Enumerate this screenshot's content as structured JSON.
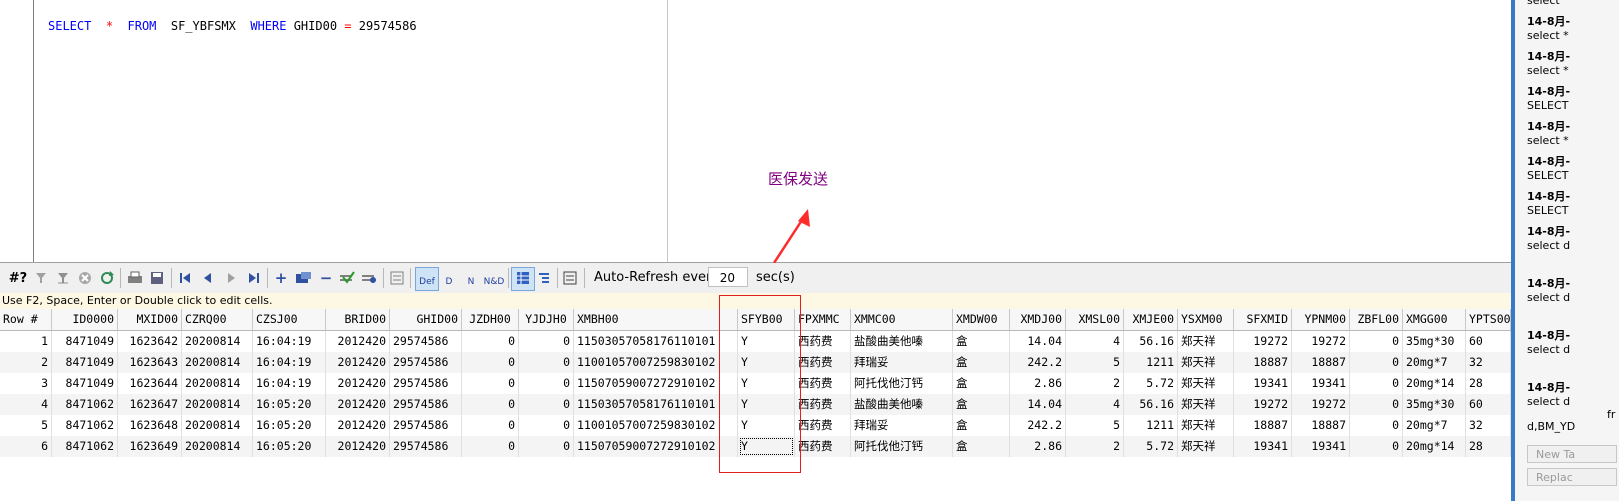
{
  "editor": {
    "sql_select": "SELECT",
    "sql_star": "*",
    "sql_from": "FROM",
    "sql_table": "SF_YBFSMX",
    "sql_where": "WHERE",
    "sql_col": "GHID00",
    "sql_eq": "=",
    "sql_val": "29574586"
  },
  "annotation": {
    "text": "医保发送",
    "color": "#ff2a2a"
  },
  "toolbar": {
    "first_label": "#?",
    "auto_refresh_label": "Auto-Refresh every",
    "refresh_seconds": "20",
    "seconds_unit": "sec(s)",
    "view_buttons": [
      "Def",
      "D",
      "N",
      "N&D"
    ]
  },
  "hint": "Use F2, Space, Enter or Double click to edit cells.",
  "grid": {
    "columns": [
      "Row #",
      "ID0000",
      "MXID00",
      "CZRQ00",
      "CZSJ00",
      "BRID00",
      "GHID00",
      "JZDH00",
      "YJDJH0",
      "XMBH00",
      "SFYB00",
      "FPXMMC",
      "XMMC00",
      "XMDW00",
      "XMDJ00",
      "XMSL00",
      "XMJE00",
      "YSXM00",
      "SFXMID",
      "YPNM00",
      "ZBFL00",
      "XMGG00",
      "YPTS00"
    ],
    "rows": [
      [
        "1",
        "8471049",
        "1623642",
        "20200814",
        "16:04:19",
        "2012420",
        "29574586",
        "0",
        "0",
        "11503057058176110101",
        "Y",
        "西药费",
        "盐酸曲美他嗪",
        "盒",
        "14.04",
        "4",
        "56.16",
        "郑天祥",
        "19272",
        "19272",
        "0",
        "35mg*30",
        "60"
      ],
      [
        "2",
        "8471049",
        "1623643",
        "20200814",
        "16:04:19",
        "2012420",
        "29574586",
        "0",
        "0",
        "11001057007259830102",
        "Y",
        "西药费",
        "拜瑞妥",
        "盒",
        "242.2",
        "5",
        "1211",
        "郑天祥",
        "18887",
        "18887",
        "0",
        "20mg*7",
        "32"
      ],
      [
        "3",
        "8471049",
        "1623644",
        "20200814",
        "16:04:19",
        "2012420",
        "29574586",
        "0",
        "0",
        "11507059007272910102",
        "Y",
        "西药费",
        "阿托伐他汀钙",
        "盒",
        "2.86",
        "2",
        "5.72",
        "郑天祥",
        "19341",
        "19341",
        "0",
        "20mg*14",
        "28"
      ],
      [
        "4",
        "8471062",
        "1623647",
        "20200814",
        "16:05:20",
        "2012420",
        "29574586",
        "0",
        "0",
        "11503057058176110101",
        "Y",
        "西药费",
        "盐酸曲美他嗪",
        "盒",
        "14.04",
        "4",
        "56.16",
        "郑天祥",
        "19272",
        "19272",
        "0",
        "35mg*30",
        "60"
      ],
      [
        "5",
        "8471062",
        "1623648",
        "20200814",
        "16:05:20",
        "2012420",
        "29574586",
        "0",
        "0",
        "11001057007259830102",
        "Y",
        "西药费",
        "拜瑞妥",
        "盒",
        "242.2",
        "5",
        "1211",
        "郑天祥",
        "18887",
        "18887",
        "0",
        "20mg*7",
        "32"
      ],
      [
        "6",
        "8471062",
        "1623649",
        "20200814",
        "16:05:20",
        "2012420",
        "29574586",
        "0",
        "0",
        "11507059007272910102",
        "Y",
        "西药费",
        "阿托伐他汀钙",
        "盒",
        "2.86",
        "2",
        "5.72",
        "郑天祥",
        "19341",
        "19341",
        "0",
        "20mg*14",
        "28"
      ]
    ]
  },
  "history": {
    "items": [
      {
        "date": "",
        "text": "select"
      },
      {
        "date": "14-8月-",
        "text": "select *"
      },
      {
        "date": "14-8月-",
        "text": "select *"
      },
      {
        "date": "14-8月-",
        "text": "SELECT"
      },
      {
        "date": "14-8月-",
        "text": "select *"
      },
      {
        "date": "14-8月-",
        "text": "SELECT"
      },
      {
        "date": "14-8月-",
        "text": "SELECT"
      },
      {
        "date": "14-8月-",
        "text": "select d"
      },
      {
        "date": "14-8月-",
        "text": "select d"
      },
      {
        "date": "14-8月-",
        "text": "select d"
      },
      {
        "date": "14-8月-",
        "text": "select d"
      }
    ],
    "extra_fr": "fr",
    "extra_line": "d,BM_YD",
    "new_tab_button": "New Ta",
    "replace_button": "Replac"
  }
}
